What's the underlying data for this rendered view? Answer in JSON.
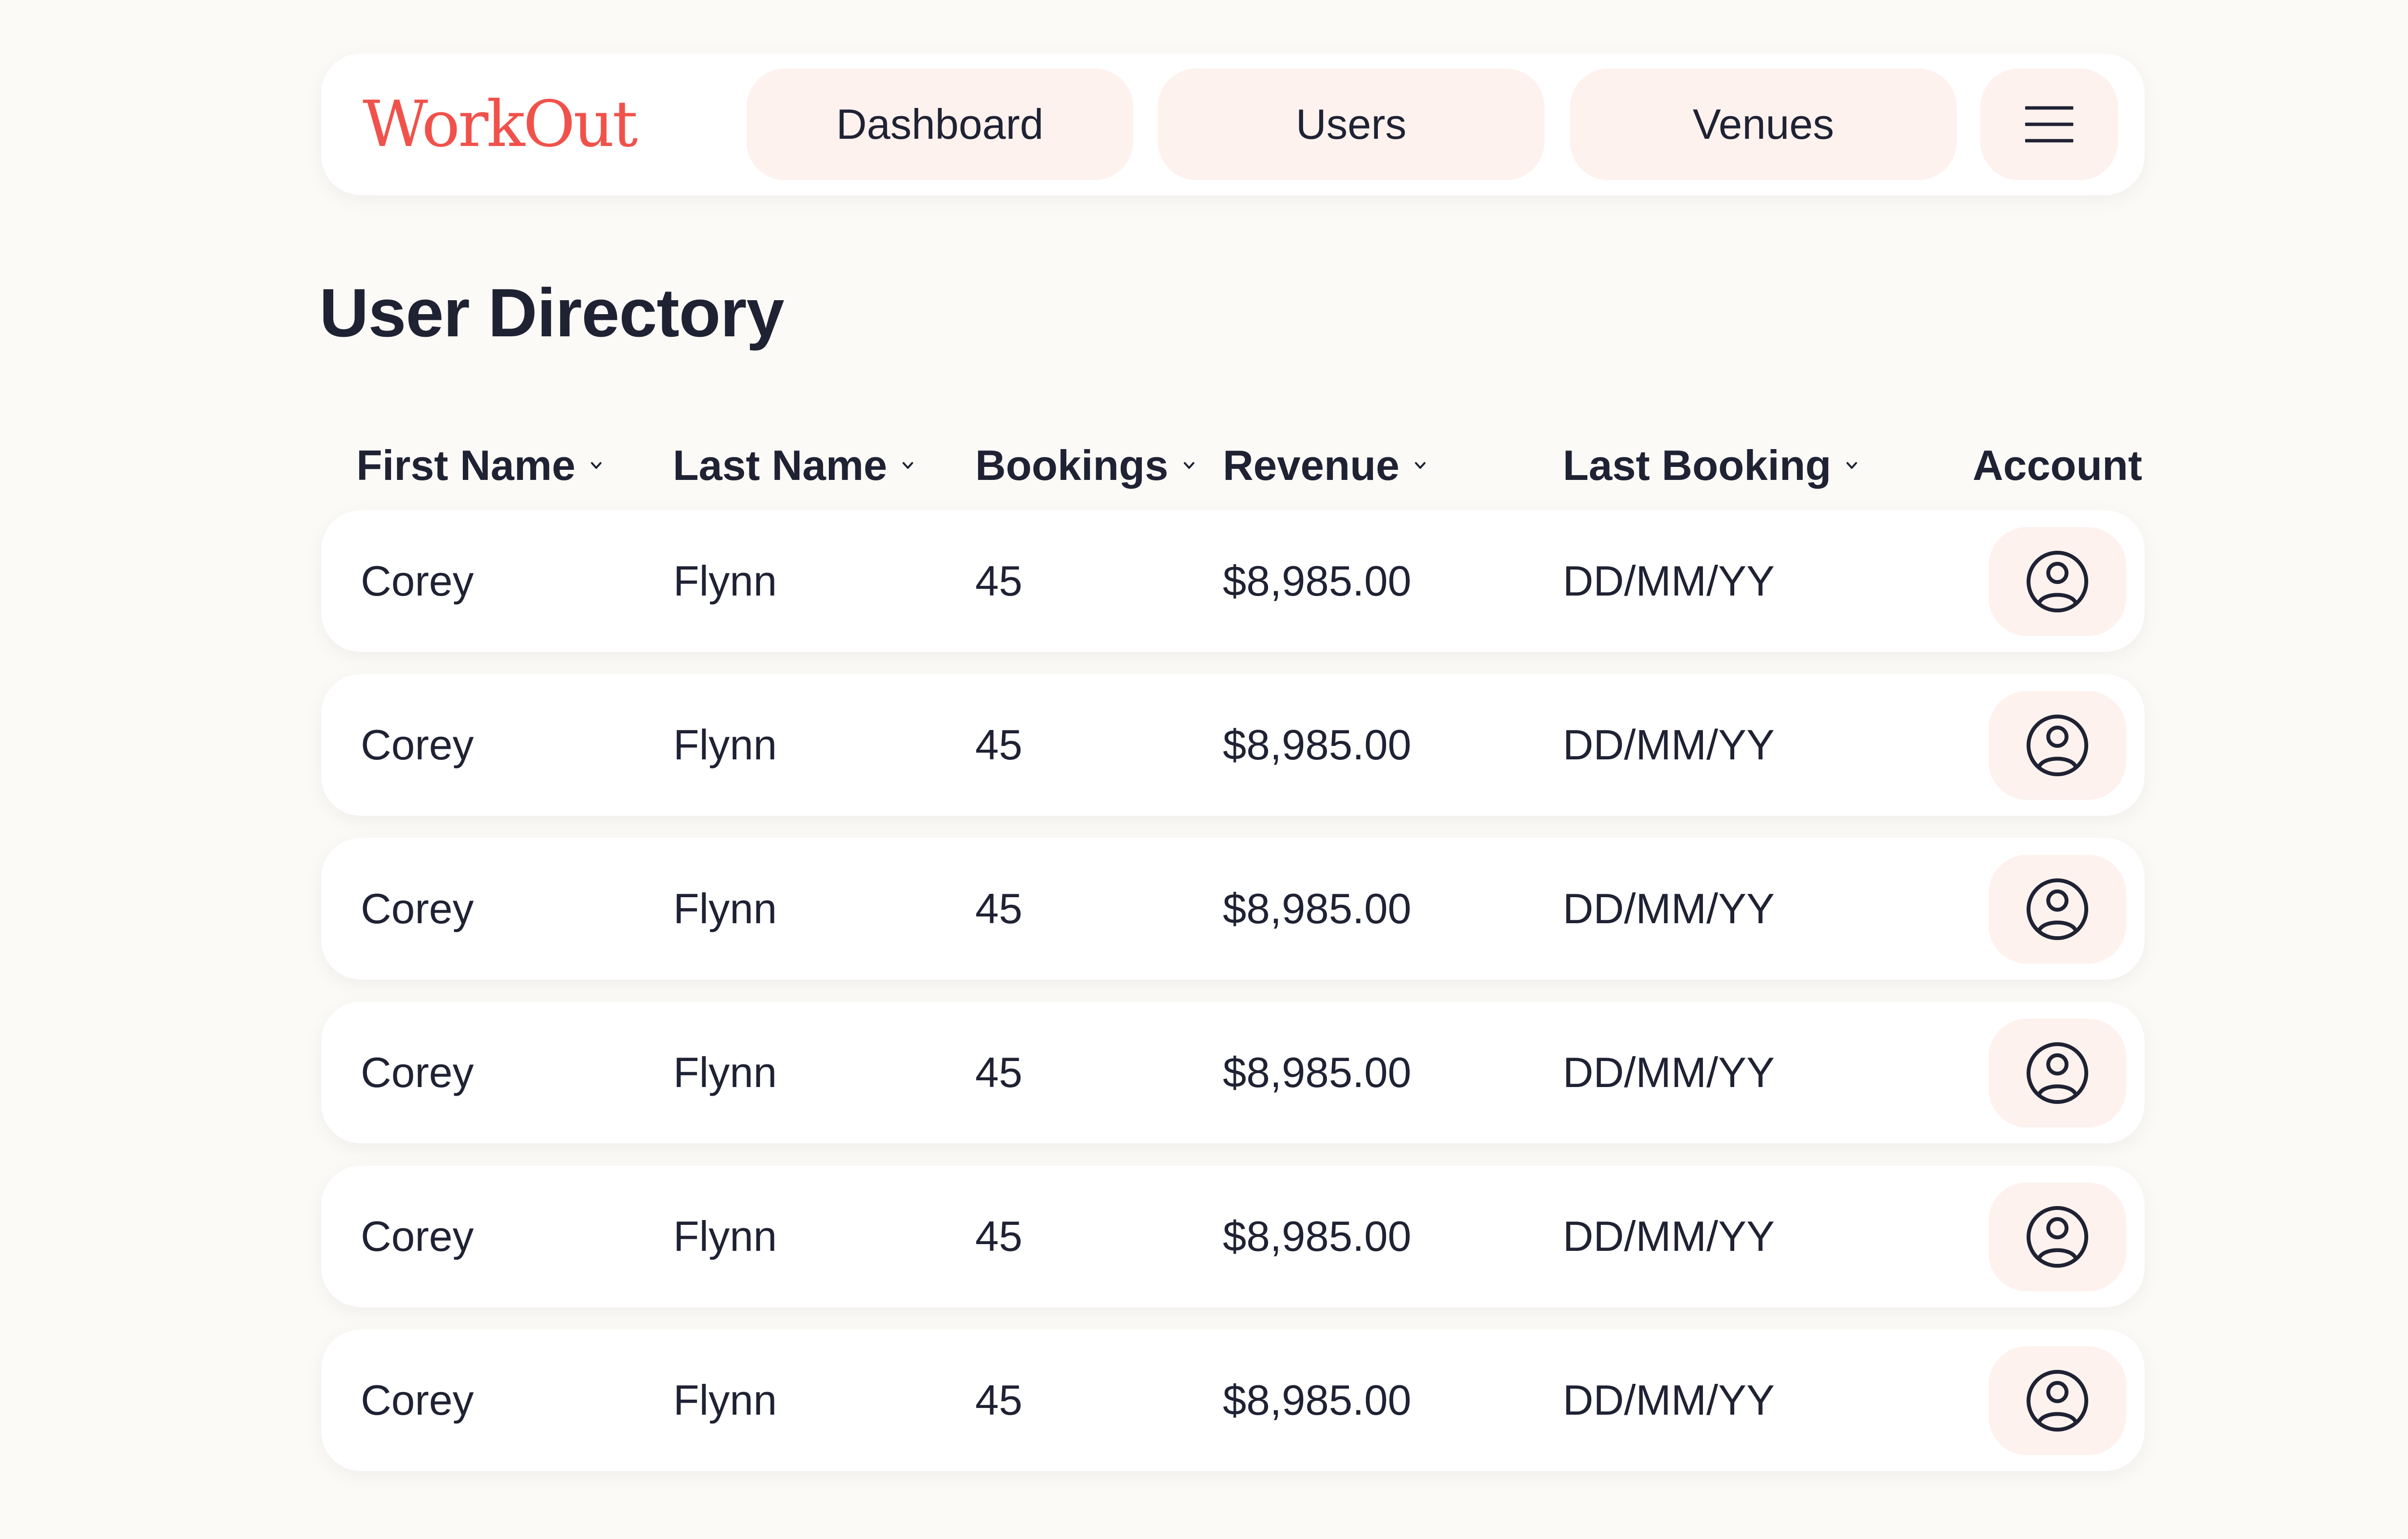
{
  "header": {
    "logo": "WorkOut",
    "nav": [
      {
        "label": "Dashboard"
      },
      {
        "label": "Users"
      },
      {
        "label": "Venues"
      }
    ],
    "menu_icon": "hamburger-menu-icon"
  },
  "page": {
    "title": "User Directory"
  },
  "table": {
    "columns": [
      {
        "label": "First Name",
        "sortable": true
      },
      {
        "label": "Last Name",
        "sortable": true
      },
      {
        "label": "Bookings",
        "sortable": true
      },
      {
        "label": "Revenue",
        "sortable": true
      },
      {
        "label": "Last Booking",
        "sortable": true
      },
      {
        "label": "Account",
        "sortable": false
      }
    ],
    "rows": [
      {
        "first": "Corey",
        "last": "Flynn",
        "bookings": "45",
        "revenue": "$8,985.00",
        "last_booking": "DD/MM/YY"
      },
      {
        "first": "Corey",
        "last": "Flynn",
        "bookings": "45",
        "revenue": "$8,985.00",
        "last_booking": "DD/MM/YY"
      },
      {
        "first": "Corey",
        "last": "Flynn",
        "bookings": "45",
        "revenue": "$8,985.00",
        "last_booking": "DD/MM/YY"
      },
      {
        "first": "Corey",
        "last": "Flynn",
        "bookings": "45",
        "revenue": "$8,985.00",
        "last_booking": "DD/MM/YY"
      },
      {
        "first": "Corey",
        "last": "Flynn",
        "bookings": "45",
        "revenue": "$8,985.00",
        "last_booking": "DD/MM/YY"
      },
      {
        "first": "Corey",
        "last": "Flynn",
        "bookings": "45",
        "revenue": "$8,985.00",
        "last_booking": "DD/MM/YY"
      }
    ],
    "account_icon": "user-account-icon",
    "sort_icon": "chevron-down-icon"
  },
  "colors": {
    "background": "#fbfaf7",
    "surface": "#ffffff",
    "brand": "#f0524b",
    "button_fill": "#fdf2ee",
    "text": "#1f2233"
  }
}
